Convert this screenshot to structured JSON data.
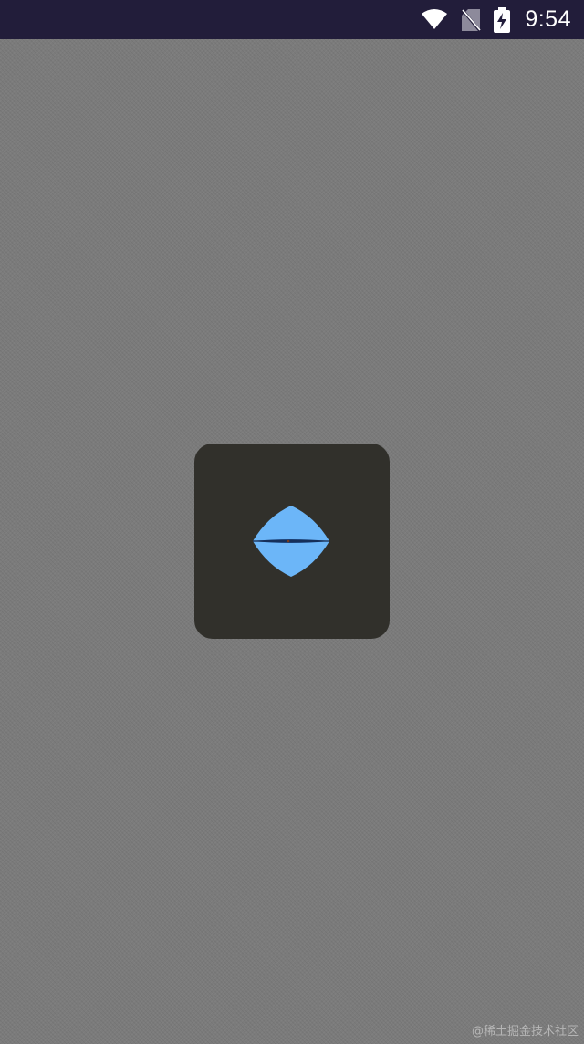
{
  "status_bar": {
    "time": "9:54",
    "icons": [
      "wifi-icon",
      "no-sim-icon",
      "battery-charging-icon"
    ],
    "background": "#221d3a"
  },
  "loading_dialog": {
    "background": "#31302b",
    "spinner_color": "#6cb6f8",
    "spinner_line_color": "#1b3f73",
    "icon": "loading-spinner-icon"
  },
  "screen": {
    "background": "#7b7b7b"
  },
  "watermark": {
    "text": "@稀土掘金技术社区"
  }
}
